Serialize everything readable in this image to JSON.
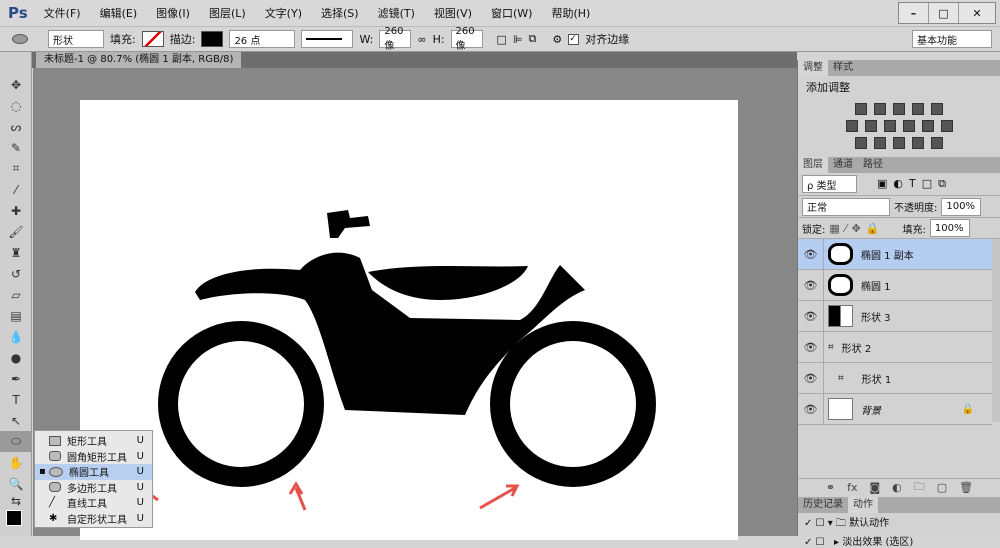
{
  "app": {
    "logo": "Ps"
  },
  "menu": [
    "文件(F)",
    "编辑(E)",
    "图像(I)",
    "图层(L)",
    "文字(Y)",
    "选择(S)",
    "滤镜(T)",
    "视图(V)",
    "窗口(W)",
    "帮助(H)"
  ],
  "window_buttons": [
    "–",
    "□",
    "✕"
  ],
  "options": {
    "mode": "形状",
    "fill_label": "填充:",
    "stroke_label": "描边:",
    "stroke_size": "26 点",
    "w_label": "W:",
    "w_value": "260 像",
    "h_label": "H:",
    "h_value": "260 像",
    "align_edges": "对齐边缘",
    "workspace": "基本功能"
  },
  "document_tab": {
    "title": "未标题-1 @ 80.7% (椭圆 1 副本, RGB/8) *",
    "close": "×"
  },
  "flyout": [
    {
      "label": "矩形工具",
      "key": "U"
    },
    {
      "label": "圆角矩形工具",
      "key": "U"
    },
    {
      "label": "椭圆工具",
      "key": "U",
      "selected": true
    },
    {
      "label": "多边形工具",
      "key": "U"
    },
    {
      "label": "直线工具",
      "key": "U"
    },
    {
      "label": "自定形状工具",
      "key": "U"
    }
  ],
  "adjust_panel": {
    "tabs": [
      "调整",
      "样式"
    ],
    "title": "添加调整"
  },
  "layers_panel": {
    "tabs": [
      "图层",
      "通道",
      "路径"
    ],
    "filter": "ρ 类型",
    "blend": "正常",
    "opacity_label": "不透明度:",
    "opacity": "100%",
    "lock_label": "锁定:",
    "fill_label": "填充:",
    "fill": "100%",
    "layers": [
      {
        "name": "椭圆 1 副本",
        "selected": true
      },
      {
        "name": "椭圆 1"
      },
      {
        "name": "形状 3"
      },
      {
        "name": "形状 2"
      },
      {
        "name": "形状 1"
      },
      {
        "name": "背景",
        "locked": true
      }
    ]
  },
  "history_panel": {
    "tabs": [
      "历史记录",
      "动作"
    ],
    "items": [
      "默认动作",
      "淡出效果 (选区)"
    ]
  },
  "colors": {
    "accent": "#b6cdf2",
    "arrow": "#e8504a"
  }
}
